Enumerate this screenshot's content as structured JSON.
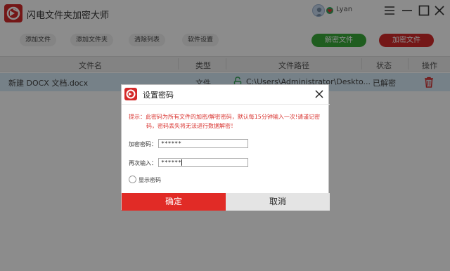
{
  "window": {
    "title": "闪电文件夹加密大师",
    "user_name": "Lyan"
  },
  "toolbar": {
    "add_file": "添加文件",
    "add_folder": "添加文件夹",
    "clear_list": "清除列表",
    "settings": "软件设置",
    "decrypt": "解密文件",
    "encrypt": "加密文件"
  },
  "table": {
    "columns": [
      "文件名",
      "类型",
      "文件路径",
      "状态",
      "操作"
    ],
    "rows": [
      {
        "name": "新建 DOCX 文档.docx",
        "type": "文件",
        "path": "C:\\Users\\Administrator\\Deskto...",
        "status": "已解密"
      }
    ]
  },
  "dialog": {
    "title": "设置密码",
    "hint_line1": "提示：此密码为所有文件的加密/解密密码，默认每15分钟输入一次!请谨记密",
    "hint_line2": "码，密码丢失将无法进行数据解密！",
    "password_label": "加密密码：",
    "password_value": "******",
    "confirm_label": "再次输入：",
    "confirm_value": "******",
    "show_password_label": "显示密码",
    "ok_label": "确定",
    "cancel_label": "取消"
  },
  "colors": {
    "brand_red": "#d42a2a",
    "decrypt_green": "#39a93a",
    "hint_red": "#d9332f",
    "row_selected": "#d8ebf8"
  }
}
